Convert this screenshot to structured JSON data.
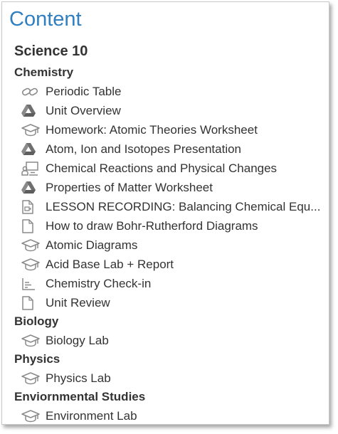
{
  "header": {
    "title": "Content"
  },
  "course": {
    "name": "Science 10"
  },
  "sections": [
    {
      "title": "Chemistry",
      "items": [
        {
          "label": "Periodic Table",
          "icon": "link-icon"
        },
        {
          "label": "Unit Overview",
          "icon": "google-drive-icon"
        },
        {
          "label": "Homework: Atomic Theories Worksheet",
          "icon": "graduation-cap-icon"
        },
        {
          "label": "Atom, Ion and Isotopes Presentation",
          "icon": "google-drive-icon"
        },
        {
          "label": "Chemical Reactions and Physical Changes",
          "icon": "presentation-icon"
        },
        {
          "label": "Properties of Matter Worksheet",
          "icon": "google-drive-icon"
        },
        {
          "label": "LESSON RECORDING: Balancing Chemical Equ...",
          "icon": "video-file-icon"
        },
        {
          "label": "How to draw Bohr-Rutherford Diagrams",
          "icon": "document-icon"
        },
        {
          "label": "Atomic Diagrams",
          "icon": "graduation-cap-icon"
        },
        {
          "label": "Acid Base Lab + Report",
          "icon": "graduation-cap-icon"
        },
        {
          "label": "Chemistry Check-in",
          "icon": "chart-icon"
        },
        {
          "label": "Unit Review",
          "icon": "document-icon"
        }
      ]
    },
    {
      "title": "Biology",
      "items": [
        {
          "label": "Biology Lab",
          "icon": "graduation-cap-icon"
        }
      ]
    },
    {
      "title": "Physics",
      "items": [
        {
          "label": "Physics Lab",
          "icon": "graduation-cap-icon"
        }
      ]
    },
    {
      "title": "Enviornmental Studies",
      "items": [
        {
          "label": "Environment Lab",
          "icon": "graduation-cap-icon"
        }
      ]
    }
  ]
}
